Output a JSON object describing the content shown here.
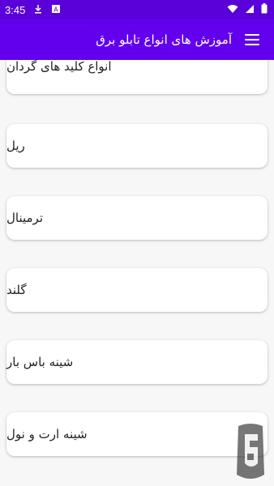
{
  "status_bar": {
    "time": "3:45",
    "left_icons": [
      "download-icon",
      "notification-a-icon"
    ],
    "right_icons": [
      "wifi-icon",
      "signal-icon",
      "battery-icon"
    ]
  },
  "app_bar": {
    "title": "آموزش های انواع تابلو برق",
    "menu_icon": "menu-icon"
  },
  "items": [
    {
      "label": "انواع کلید های گردان"
    },
    {
      "label": "ریل"
    },
    {
      "label": "ترمینال"
    },
    {
      "label": "گلند"
    },
    {
      "label": "شینه باس بار"
    },
    {
      "label": "شینه ارت و نول"
    }
  ],
  "colors": {
    "app_bar": "#6200ee",
    "status_bar": "#5a00d8"
  }
}
